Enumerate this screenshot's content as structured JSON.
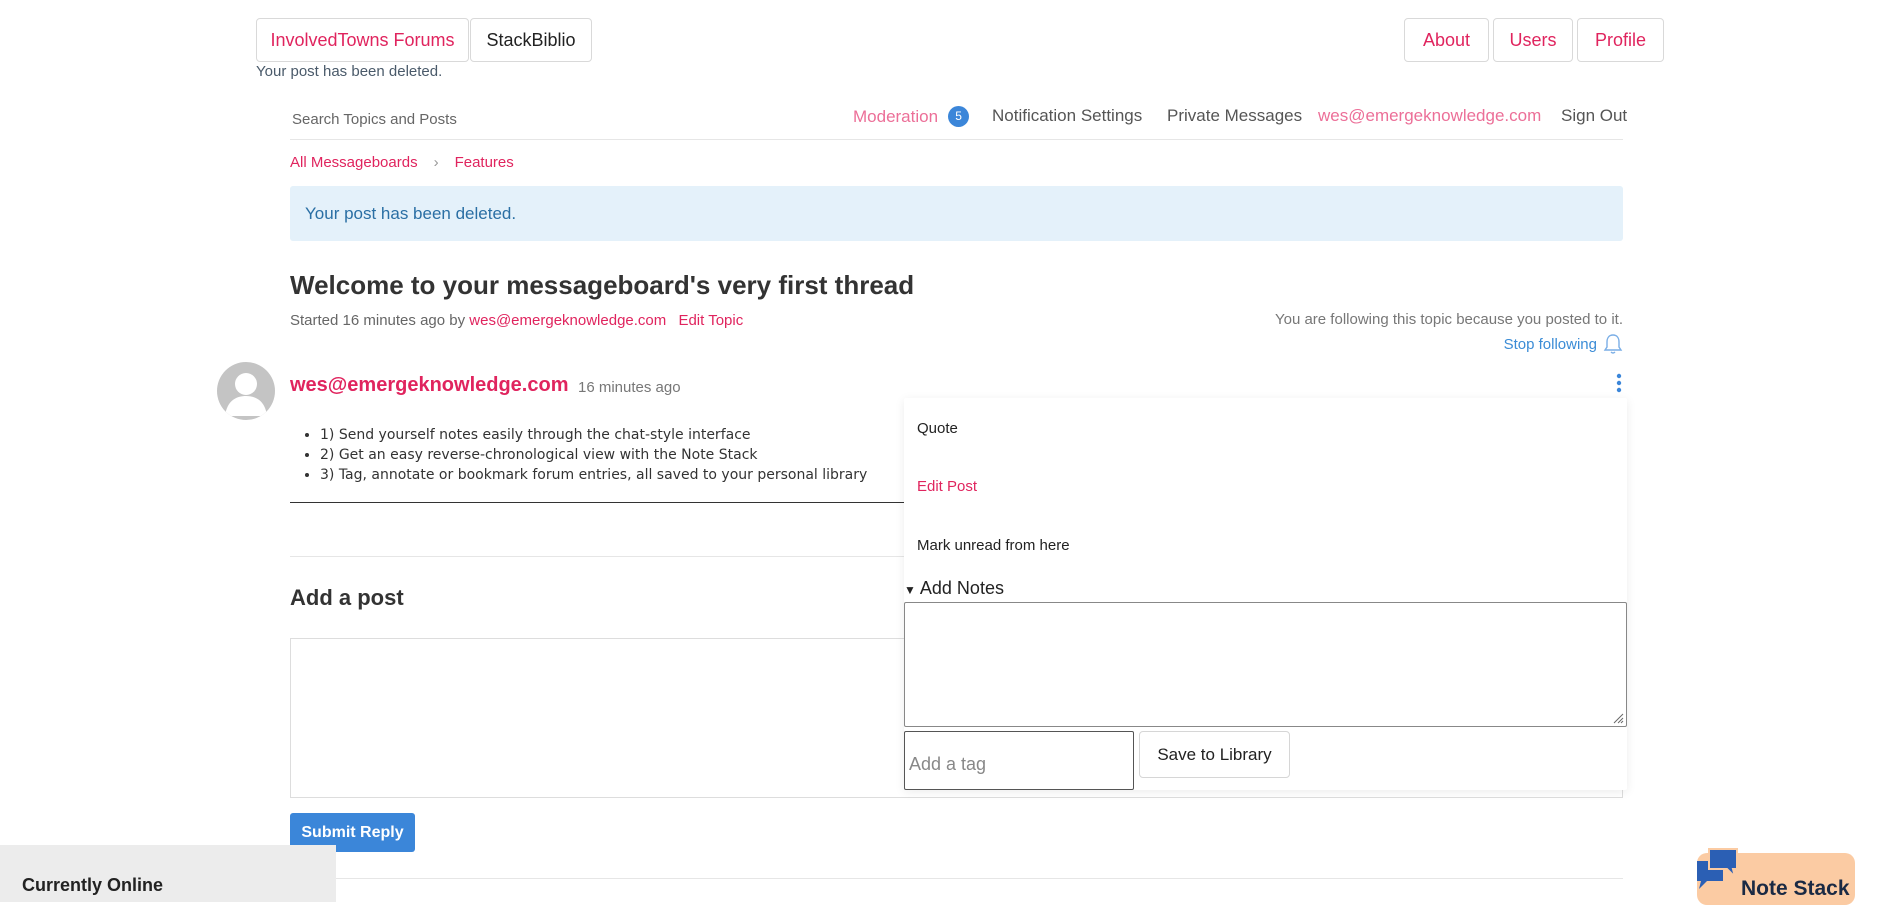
{
  "top_bar": {
    "tabs": [
      {
        "label": "InvolvedTowns Forums"
      },
      {
        "label": "StackBiblio"
      }
    ],
    "right_buttons": [
      {
        "label": "About"
      },
      {
        "label": "Users"
      },
      {
        "label": "Profile"
      }
    ],
    "flash_message": "Your post has been deleted."
  },
  "nav": {
    "search_placeholder": "Search Topics and Posts",
    "moderation_label": "Moderation",
    "moderation_count": "5",
    "notification_settings": "Notification Settings",
    "private_messages": "Private Messages",
    "user_email": "wes@emergeknowledge.com",
    "sign_out": "Sign Out"
  },
  "breadcrumb": {
    "items": [
      "All Messageboards",
      "Features"
    ],
    "separator": "›"
  },
  "alert": {
    "text": "Your post has been deleted."
  },
  "topic": {
    "title": "Welcome to your messageboard's very first thread",
    "started_prefix": "Started 16 minutes ago by",
    "started_by": "wes@emergeknowledge.com",
    "edit_topic": "Edit Topic",
    "following_note": "You are following this topic because you posted to it.",
    "stop_following": "Stop following"
  },
  "post": {
    "author": "wes@emergeknowledge.com",
    "time": "16 minutes ago",
    "items": [
      "1) Send yourself notes easily through the chat-style interface",
      "2) Get an easy reverse-chronological view with the Note Stack",
      "3) Tag, annotate or bookmark forum entries, all saved to your personal library"
    ]
  },
  "post_menu": {
    "items": [
      "Quote",
      "Edit Post",
      "Mark unread from here"
    ],
    "add_notes_label": "Add Notes",
    "tag_placeholder": "Add a tag",
    "save_button": "Save to Library"
  },
  "reply": {
    "heading": "Add a post",
    "submit": "Submit Reply"
  },
  "footer": {
    "currently_online": "Currently Online",
    "note_stack": "Note Stack"
  },
  "colors": {
    "accent_pink": "#e0245e",
    "link_blue": "#3b8cd6",
    "alert_bg": "#e4f1fa",
    "note_stack_bg": "#fbcba3"
  }
}
